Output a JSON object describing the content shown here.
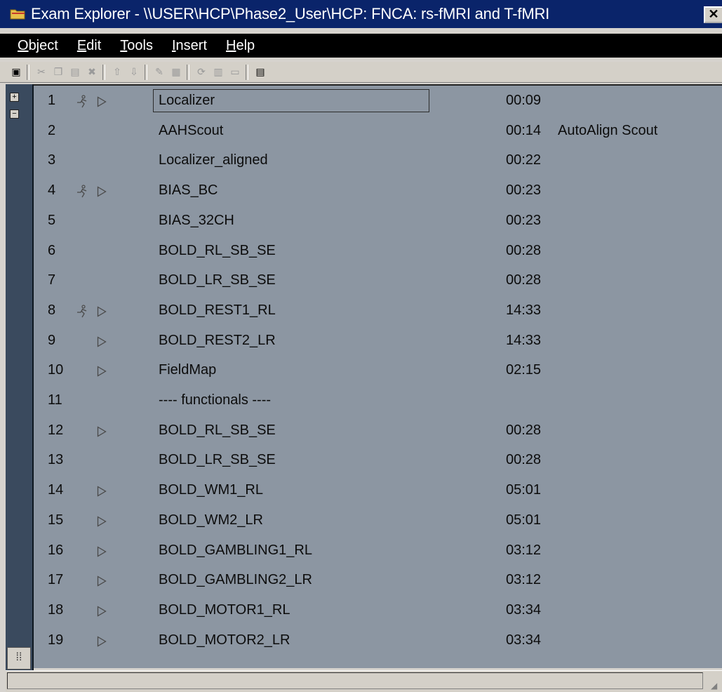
{
  "window": {
    "title": "Exam Explorer - \\\\USER\\HCP\\Phase2_User\\HCP: FNCA: rs-fMRI and T-fMRI",
    "close_label": "✕"
  },
  "menu": [
    {
      "label": "Object",
      "mnemonic": "O",
      "rest": "bject"
    },
    {
      "label": "Edit",
      "mnemonic": "E",
      "rest": "dit"
    },
    {
      "label": "Tools",
      "mnemonic": "T",
      "rest": "ools"
    },
    {
      "label": "Insert",
      "mnemonic": "I",
      "rest": "nsert"
    },
    {
      "label": "Help",
      "mnemonic": "H",
      "rest": "elp"
    }
  ],
  "toolbar": {
    "buttons": [
      {
        "icon": "open-program-icon",
        "enabled": true
      },
      {
        "icon": "cut-icon",
        "enabled": false
      },
      {
        "icon": "copy-icon",
        "enabled": false
      },
      {
        "icon": "paste-icon",
        "enabled": false
      },
      {
        "icon": "delete-icon",
        "enabled": false
      },
      {
        "icon": "move-up-icon",
        "enabled": false
      },
      {
        "icon": "move-down-icon",
        "enabled": false
      },
      {
        "icon": "edit-icon",
        "enabled": false
      },
      {
        "icon": "properties-icon",
        "enabled": false
      },
      {
        "icon": "rename-icon",
        "enabled": false
      },
      {
        "icon": "save-icon",
        "enabled": false
      },
      {
        "icon": "save-as-icon",
        "enabled": false
      },
      {
        "icon": "details-icon",
        "enabled": true
      }
    ]
  },
  "protocols": [
    {
      "num": "1",
      "run": true,
      "play": true,
      "name": "Localizer",
      "time": "00:09",
      "comment": "",
      "selected": true
    },
    {
      "num": "2",
      "run": false,
      "play": false,
      "name": "AAHScout",
      "time": "00:14",
      "comment": "AutoAlign Scout"
    },
    {
      "num": "3",
      "run": false,
      "play": false,
      "name": "Localizer_aligned",
      "time": "00:22",
      "comment": ""
    },
    {
      "num": "4",
      "run": true,
      "play": true,
      "name": "BIAS_BC",
      "time": "00:23",
      "comment": ""
    },
    {
      "num": "5",
      "run": false,
      "play": false,
      "name": "BIAS_32CH",
      "time": "00:23",
      "comment": ""
    },
    {
      "num": "6",
      "run": false,
      "play": false,
      "name": "BOLD_RL_SB_SE",
      "time": "00:28",
      "comment": ""
    },
    {
      "num": "7",
      "run": false,
      "play": false,
      "name": "BOLD_LR_SB_SE",
      "time": "00:28",
      "comment": ""
    },
    {
      "num": "8",
      "run": true,
      "play": true,
      "name": "BOLD_REST1_RL",
      "time": "14:33",
      "comment": ""
    },
    {
      "num": "9",
      "run": false,
      "play": true,
      "name": "BOLD_REST2_LR",
      "time": "14:33",
      "comment": ""
    },
    {
      "num": "10",
      "run": false,
      "play": true,
      "name": "FieldMap",
      "time": "02:15",
      "comment": ""
    },
    {
      "num": "11",
      "run": false,
      "play": false,
      "name": "---- functionals ----",
      "time": "",
      "comment": ""
    },
    {
      "num": "12",
      "run": false,
      "play": true,
      "name": "BOLD_RL_SB_SE",
      "time": "00:28",
      "comment": ""
    },
    {
      "num": "13",
      "run": false,
      "play": false,
      "name": "BOLD_LR_SB_SE",
      "time": "00:28",
      "comment": ""
    },
    {
      "num": "14",
      "run": false,
      "play": true,
      "name": "BOLD_WM1_RL",
      "time": "05:01",
      "comment": ""
    },
    {
      "num": "15",
      "run": false,
      "play": true,
      "name": "BOLD_WM2_LR",
      "time": "05:01",
      "comment": ""
    },
    {
      "num": "16",
      "run": false,
      "play": true,
      "name": "BOLD_GAMBLING1_RL",
      "time": "03:12",
      "comment": ""
    },
    {
      "num": "17",
      "run": false,
      "play": true,
      "name": "BOLD_GAMBLING2_LR",
      "time": "03:12",
      "comment": ""
    },
    {
      "num": "18",
      "run": false,
      "play": true,
      "name": "BOLD_MOTOR1_RL",
      "time": "03:34",
      "comment": ""
    },
    {
      "num": "19",
      "run": false,
      "play": true,
      "name": "BOLD_MOTOR2_LR",
      "time": "03:34",
      "comment": ""
    }
  ],
  "status": {
    "text": ""
  },
  "colors": {
    "titlebar": "#0a246a",
    "menubar": "#000000",
    "list_background": "#8c96a2",
    "tree_strip": "#3a4a5e"
  }
}
